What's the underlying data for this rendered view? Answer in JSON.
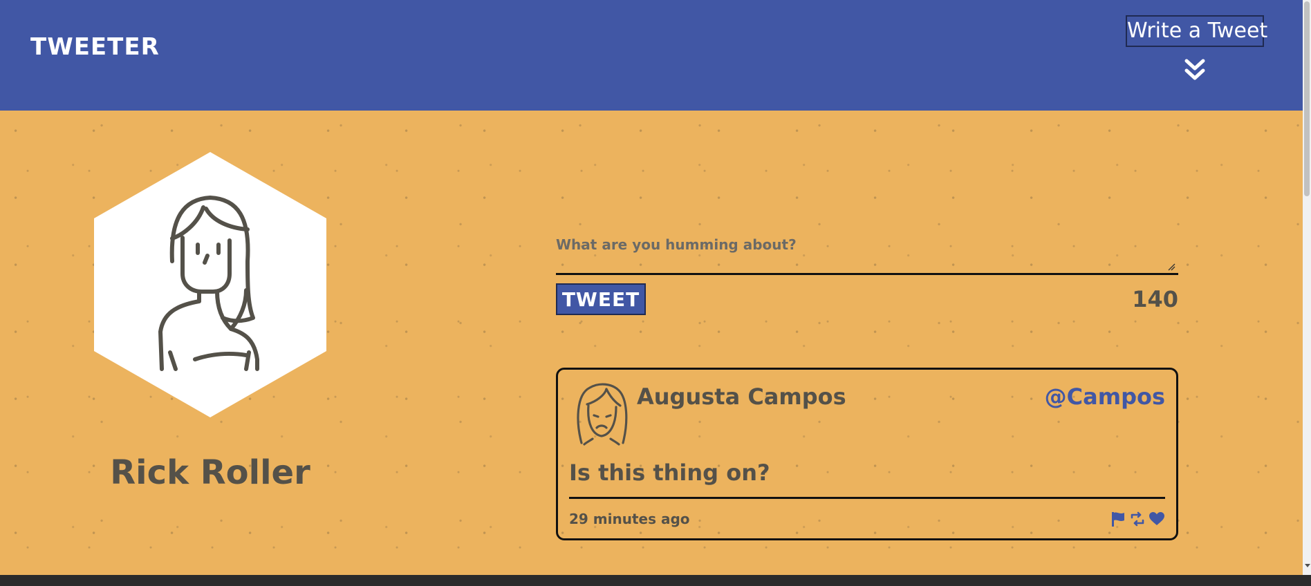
{
  "navbar": {
    "brand": "TWEETER",
    "compose_toggle_label": "Write a Tweet",
    "compose_toggle_icon": "chevron-double-down-icon"
  },
  "profile": {
    "name": "Rick Roller",
    "avatar_icon": "woman-avatar-icon"
  },
  "compose": {
    "placeholder": "What are you humming about?",
    "value": "",
    "submit_label": "TWEET",
    "char_counter": "140"
  },
  "tweets": [
    {
      "author_name": "Augusta Campos",
      "handle": "@Campos",
      "text": "Is this thing on?",
      "timestamp": "29 minutes ago",
      "avatar_icon": "sad-woman-avatar-icon",
      "actions": [
        "flag-icon",
        "retweet-icon",
        "heart-icon"
      ]
    }
  ],
  "colors": {
    "navbar": "#4157a5",
    "background": "#ecb35e",
    "text": "#545149",
    "accent": "#4157a5",
    "border": "#111111"
  }
}
